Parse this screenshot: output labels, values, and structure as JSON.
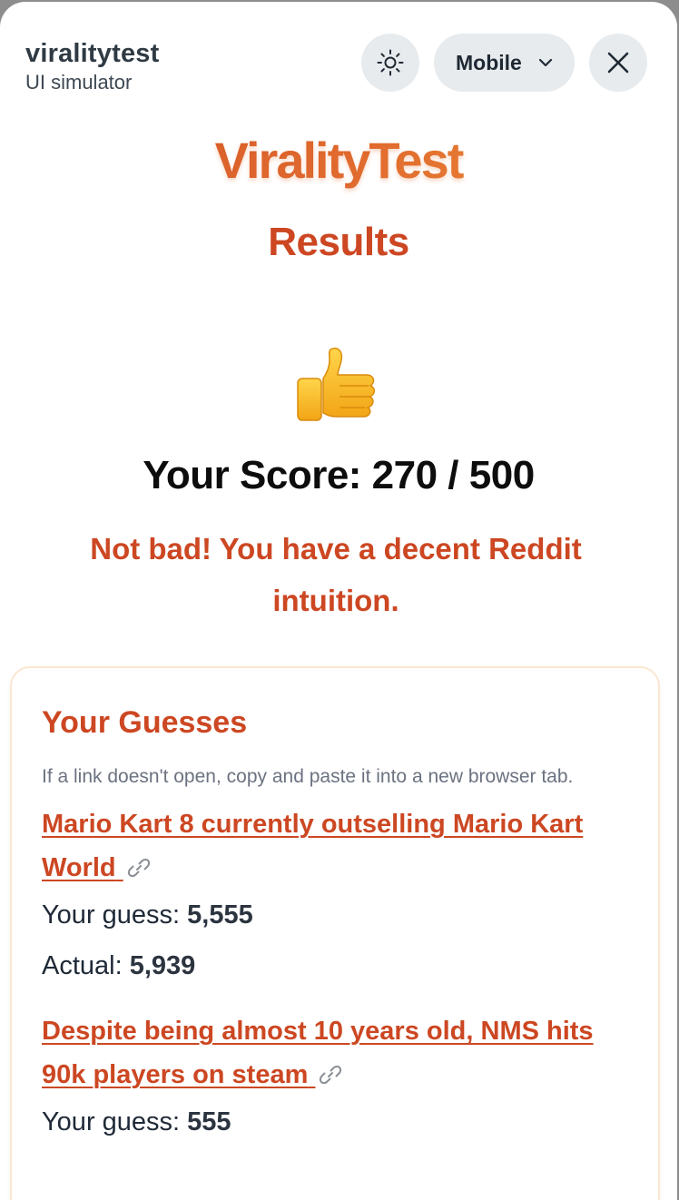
{
  "simulator": {
    "app_name": "viralitytest",
    "subtitle": "UI simulator",
    "device_label": "Mobile",
    "icons": {
      "theme": "sun-icon",
      "device_dropdown": "chevron-down-icon",
      "close": "close-icon"
    }
  },
  "page": {
    "brand": "ViralityTest",
    "title": "Results",
    "score_emoji": "thumbs-up-icon",
    "score_label": "Your Score: 270 / 500",
    "verdict": "Not bad! You have a decent Reddit intuition."
  },
  "guesses": {
    "title": "Your Guesses",
    "hint": "If a link doesn't open, copy and paste it into a new browser tab.",
    "your_guess_label": "Your guess:",
    "actual_label": "Actual:",
    "items": [
      {
        "title": "Mario Kart 8 currently outselling Mario Kart World",
        "guess": "5,555",
        "actual": "5,939"
      },
      {
        "title": "Despite being almost 10 years old, NMS hits 90k players on steam",
        "guess": "555",
        "actual": ""
      }
    ]
  },
  "colors": {
    "accent": "#cc4722",
    "brand_gradient_start": "#cf4b24",
    "brand_gradient_end": "#f09a3c",
    "control_bg": "#e7ebee",
    "card_border": "#fbe7d0"
  }
}
